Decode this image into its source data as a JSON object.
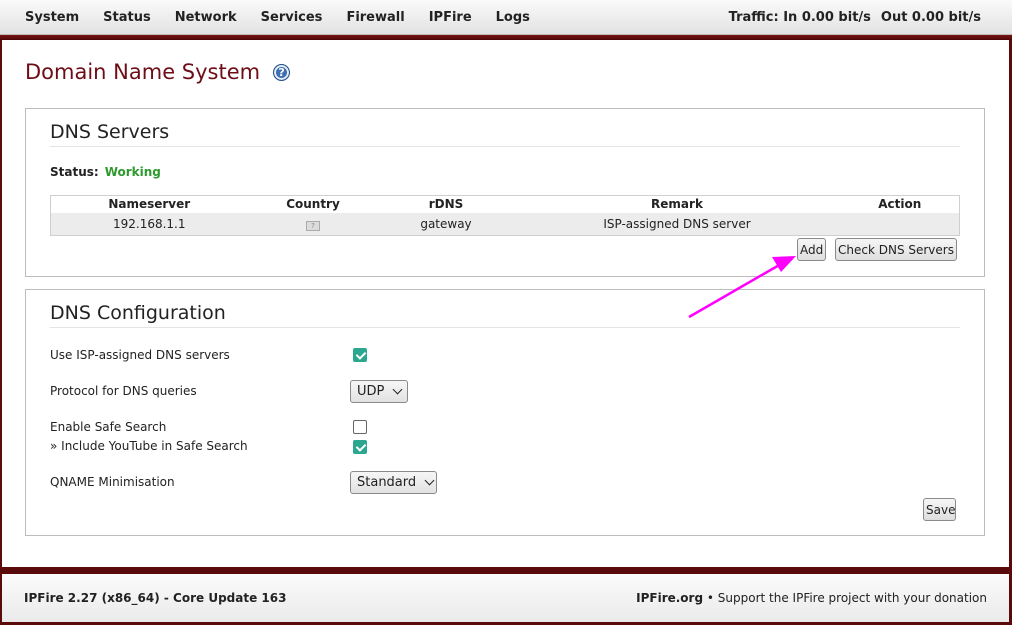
{
  "nav": {
    "items": [
      "System",
      "Status",
      "Network",
      "Services",
      "Firewall",
      "IPFire",
      "Logs"
    ],
    "traffic_in": "Traffic: In 0.00 bit/s",
    "traffic_out": "Out 0.00 bit/s"
  },
  "page": {
    "title": "Domain Name System",
    "help_icon": "help-icon"
  },
  "dns_servers": {
    "heading": "DNS Servers",
    "status_label": "Status:",
    "status_value": "Working",
    "status_color": "#2e9a2e",
    "columns": [
      "Nameserver",
      "Country",
      "rDNS",
      "Remark",
      "Action"
    ],
    "rows": [
      {
        "nameserver": "192.168.1.1",
        "country": "unknown-flag-icon",
        "rdns": "gateway",
        "remark": "ISP-assigned DNS server",
        "action": ""
      }
    ],
    "add_label": "Add",
    "check_label": "Check DNS Servers"
  },
  "dns_config": {
    "heading": "DNS Configuration",
    "use_isp_label": "Use ISP-assigned DNS servers",
    "use_isp_checked": true,
    "protocol_label": "Protocol for DNS queries",
    "protocol_value": "UDP",
    "safe_search_label": "Enable Safe Search",
    "safe_search_checked": false,
    "youtube_label": "» Include YouTube in Safe Search",
    "youtube_checked": true,
    "qname_label": "QNAME Minimisation",
    "qname_value": "Standard",
    "save_label": "Save"
  },
  "footer": {
    "version": "IPFire 2.27 (x86_64) - Core Update 163",
    "org": "IPFire.org",
    "donate": "• Support the IPFire project with your donation"
  },
  "colors": {
    "accent": "#6d0d16",
    "checkbox": "#2ba78f",
    "annotation_arrow": "#ff00ff"
  }
}
